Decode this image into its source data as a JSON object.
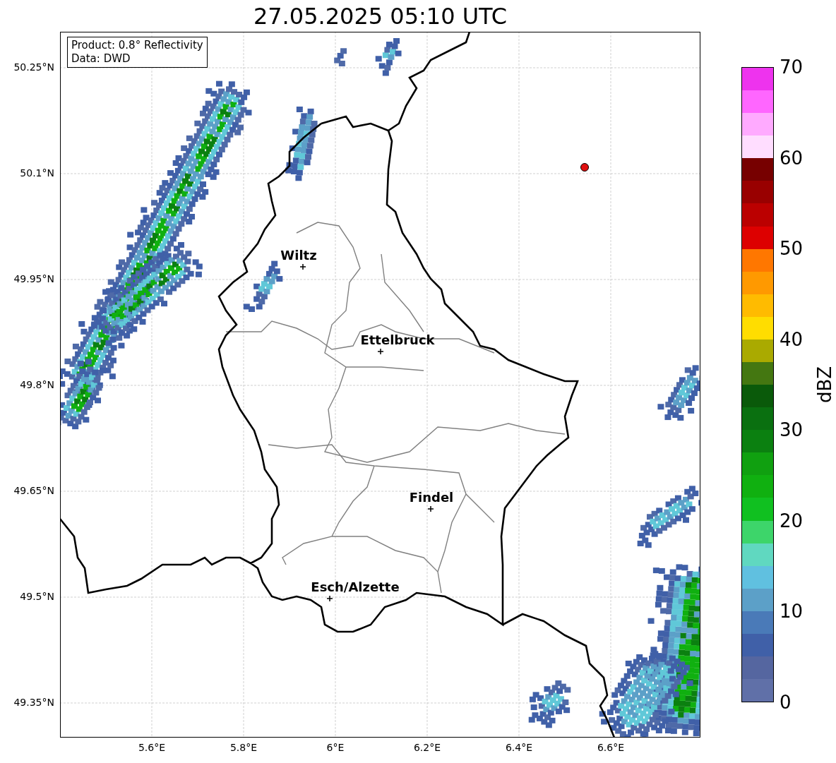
{
  "title": "27.05.2025 05:10 UTC",
  "info_box": [
    "Product: 0.8° Reflectivity",
    "Data: DWD"
  ],
  "y_ticks": [
    "50.25°N",
    "50.1°N",
    "49.95°N",
    "49.8°N",
    "49.65°N",
    "49.5°N",
    "49.35°N"
  ],
  "x_ticks": [
    "5.6°E",
    "5.8°E",
    "6°E",
    "6.2°E",
    "6.4°E",
    "6.6°E"
  ],
  "cities": [
    {
      "name": "Wiltz"
    },
    {
      "name": "Ettelbruck"
    },
    {
      "name": "Findel"
    },
    {
      "name": "Esch/Alzette"
    }
  ],
  "colorbar": {
    "label": "dBZ",
    "ticks": [
      "70",
      "60",
      "50",
      "40",
      "30",
      "20",
      "10",
      "0"
    ],
    "bands": [
      {
        "color": "#ee33ee"
      },
      {
        "color": "#ff66ff"
      },
      {
        "color": "#ffaaff"
      },
      {
        "color": "#ffddff"
      },
      {
        "color": "#770000"
      },
      {
        "color": "#990000"
      },
      {
        "color": "#bb0000"
      },
      {
        "color": "#dd0000"
      },
      {
        "color": "#ff7700"
      },
      {
        "color": "#ff9900"
      },
      {
        "color": "#ffbb00"
      },
      {
        "color": "#ffdd00"
      },
      {
        "color": "#aaaa00"
      },
      {
        "color": "#447711"
      },
      {
        "color": "#0a5a0a"
      },
      {
        "color": "#0a7010"
      },
      {
        "color": "#0b8010"
      },
      {
        "color": "#10a010"
      },
      {
        "color": "#10b010"
      },
      {
        "color": "#10c020"
      },
      {
        "color": "#3dd56a"
      },
      {
        "color": "#60d8c0"
      },
      {
        "color": "#60c0e0"
      },
      {
        "color": "#5ca0c8"
      },
      {
        "color": "#4a7ab8"
      },
      {
        "color": "#4060a8"
      },
      {
        "color": "#5566a0"
      },
      {
        "color": "#6070a8"
      }
    ]
  }
}
